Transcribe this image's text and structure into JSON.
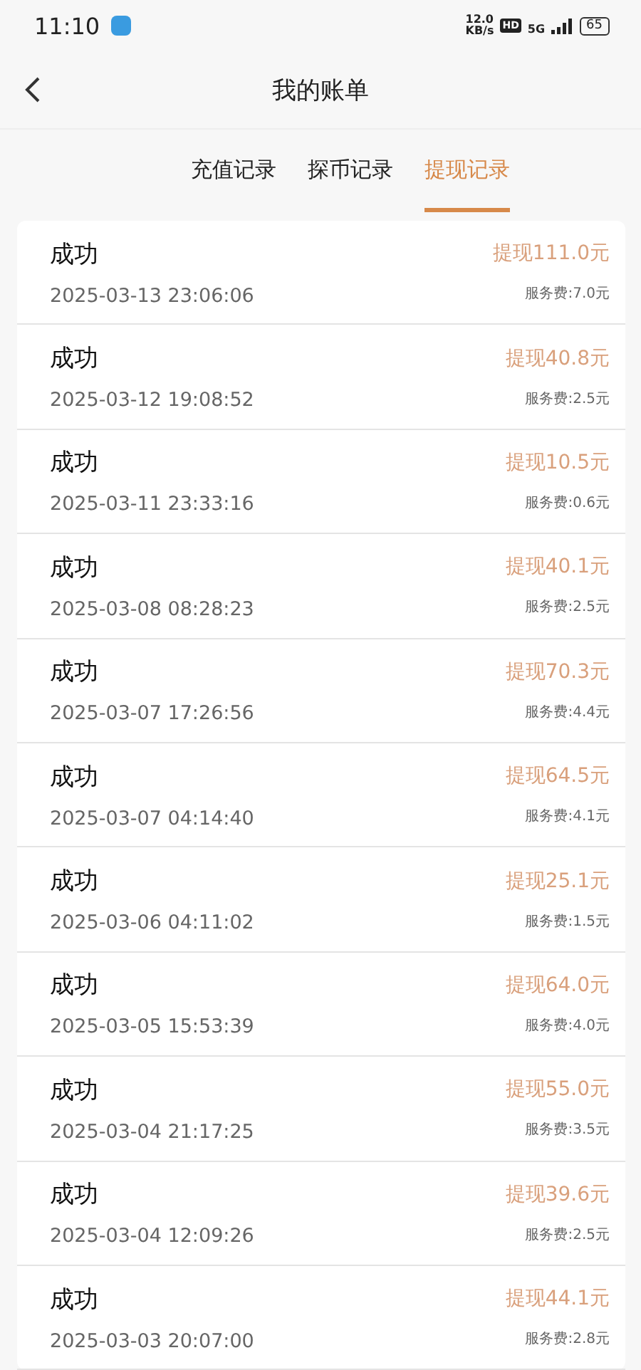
{
  "status_bar": {
    "time": "11:10",
    "speed_value": "12.0",
    "speed_unit": "KB/s",
    "hd": "HD",
    "network": "5G",
    "battery": "65"
  },
  "header": {
    "title": "我的账单"
  },
  "tabs": [
    {
      "label": "充值记录",
      "selected": false
    },
    {
      "label": "探币记录",
      "selected": false
    },
    {
      "label": "提现记录",
      "selected": true
    }
  ],
  "records": [
    {
      "status": "成功",
      "time": "2025-03-13 23:06:06",
      "amount": "提现111.0元",
      "fee": "服务费:7.0元"
    },
    {
      "status": "成功",
      "time": "2025-03-12 19:08:52",
      "amount": "提现40.8元",
      "fee": "服务费:2.5元"
    },
    {
      "status": "成功",
      "time": "2025-03-11 23:33:16",
      "amount": "提现10.5元",
      "fee": "服务费:0.6元"
    },
    {
      "status": "成功",
      "time": "2025-03-08 08:28:23",
      "amount": "提现40.1元",
      "fee": "服务费:2.5元"
    },
    {
      "status": "成功",
      "time": "2025-03-07 17:26:56",
      "amount": "提现70.3元",
      "fee": "服务费:4.4元"
    },
    {
      "status": "成功",
      "time": "2025-03-07 04:14:40",
      "amount": "提现64.5元",
      "fee": "服务费:4.1元"
    },
    {
      "status": "成功",
      "time": "2025-03-06 04:11:02",
      "amount": "提现25.1元",
      "fee": "服务费:1.5元"
    },
    {
      "status": "成功",
      "time": "2025-03-05 15:53:39",
      "amount": "提现64.0元",
      "fee": "服务费:4.0元"
    },
    {
      "status": "成功",
      "time": "2025-03-04 21:17:25",
      "amount": "提现55.0元",
      "fee": "服务费:3.5元"
    },
    {
      "status": "成功",
      "time": "2025-03-04 12:09:26",
      "amount": "提现39.6元",
      "fee": "服务费:2.5元"
    },
    {
      "status": "成功",
      "time": "2025-03-03 20:07:00",
      "amount": "提现44.1元",
      "fee": "服务费:2.8元"
    }
  ]
}
